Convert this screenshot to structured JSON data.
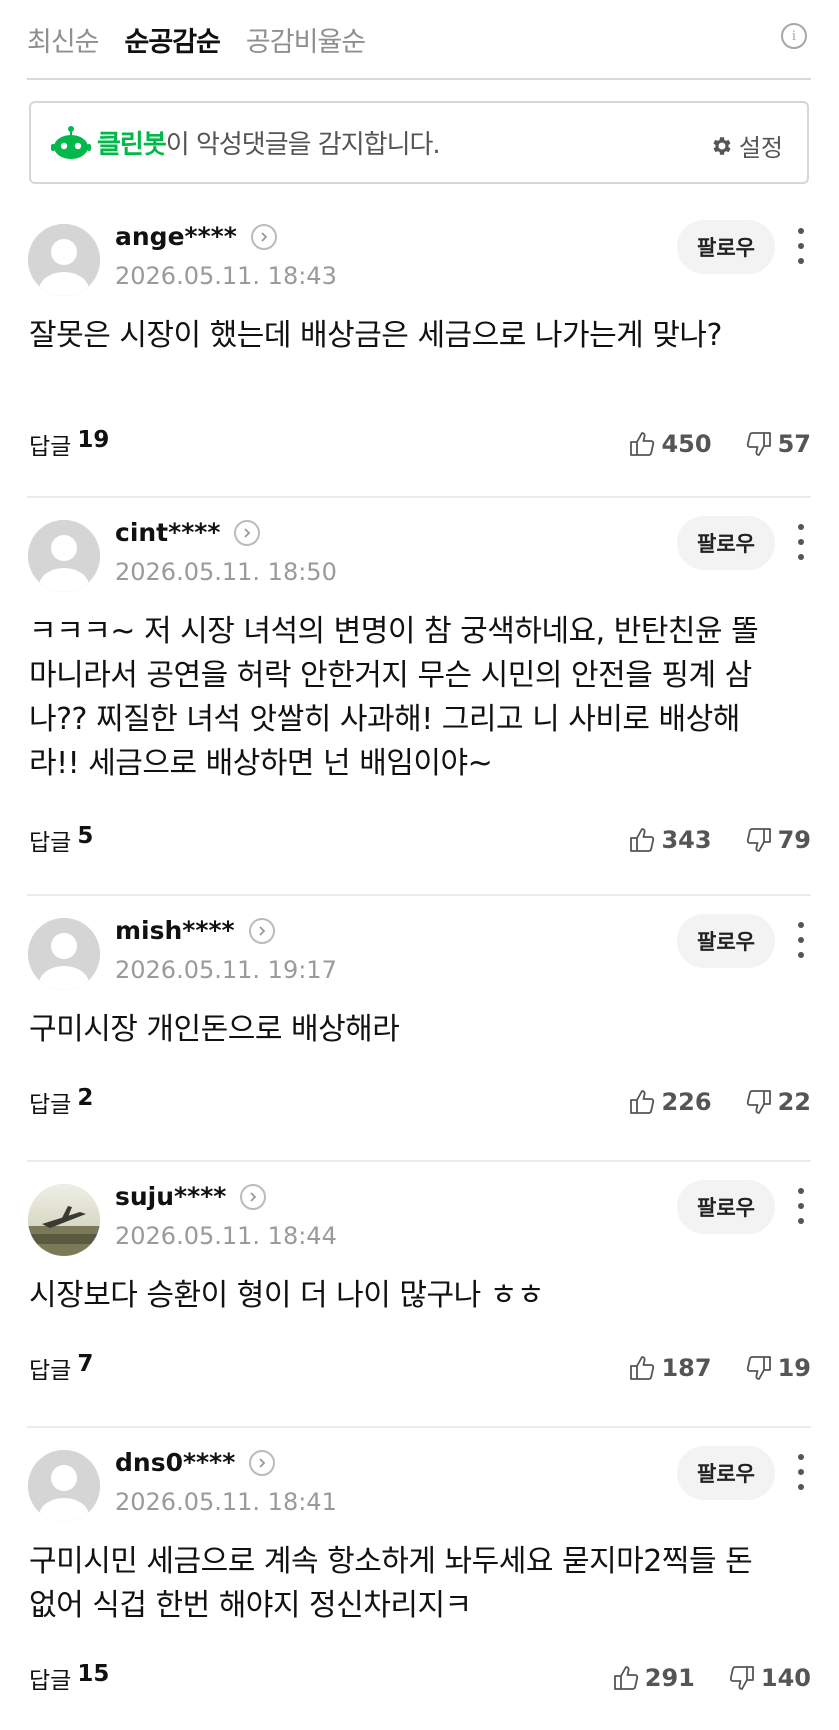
{
  "sort_tabs": [
    {
      "label": "최신순",
      "active": false
    },
    {
      "label": "순공감순",
      "active": true
    },
    {
      "label": "공감비율순",
      "active": false
    }
  ],
  "info_icon": "info-icon",
  "cleanbot": {
    "name": "클린봇",
    "text": "이 악성댓글을 감지합니다.",
    "settings_label": "설정",
    "brand_color": "#03b84a"
  },
  "follow_label": "팔로우",
  "reply_label": "답글",
  "comments": [
    {
      "username": "ange****",
      "date": "2026.05.11. 18:43",
      "content": "잘못은 시장이 했는데 배상금은 세금으로 나가는게 맞나?",
      "replies": "19",
      "likes": "450",
      "dislikes": "57",
      "avatar": "default"
    },
    {
      "username": "cint****",
      "date": "2026.05.11. 18:50",
      "content": "ㅋㅋㅋ~ 저 시장 녀석의 변명이 참 궁색하네요, 반탄친윤 똘마니라서 공연을 허락 안한거지 무슨 시민의 안전을 핑계 삼나?? 찌질한 녀석 앗쌀히 사과해! 그리고 니 사비로 배상해라!! 세금으로 배상하면 넌 배임이야~",
      "replies": "5",
      "likes": "343",
      "dislikes": "79",
      "avatar": "default"
    },
    {
      "username": "mish****",
      "date": "2026.05.11. 19:17",
      "content": "구미시장 개인돈으로 배상해라",
      "replies": "2",
      "likes": "226",
      "dislikes": "22",
      "avatar": "default"
    },
    {
      "username": "suju****",
      "date": "2026.05.11. 18:44",
      "content": "시장보다 승환이 형이 더 나이 많구나 ㅎㅎ",
      "replies": "7",
      "likes": "187",
      "dislikes": "19",
      "avatar": "photo"
    },
    {
      "username": "dns0****",
      "date": "2026.05.11. 18:41",
      "content": "구미시민 세금으로 계속 항소하게 놔두세요 묻지마2찍들 돈없어 식겁 한번 해야지 정신차리지ㅋ",
      "replies": "15",
      "likes": "291",
      "dislikes": "140",
      "avatar": "default"
    }
  ]
}
